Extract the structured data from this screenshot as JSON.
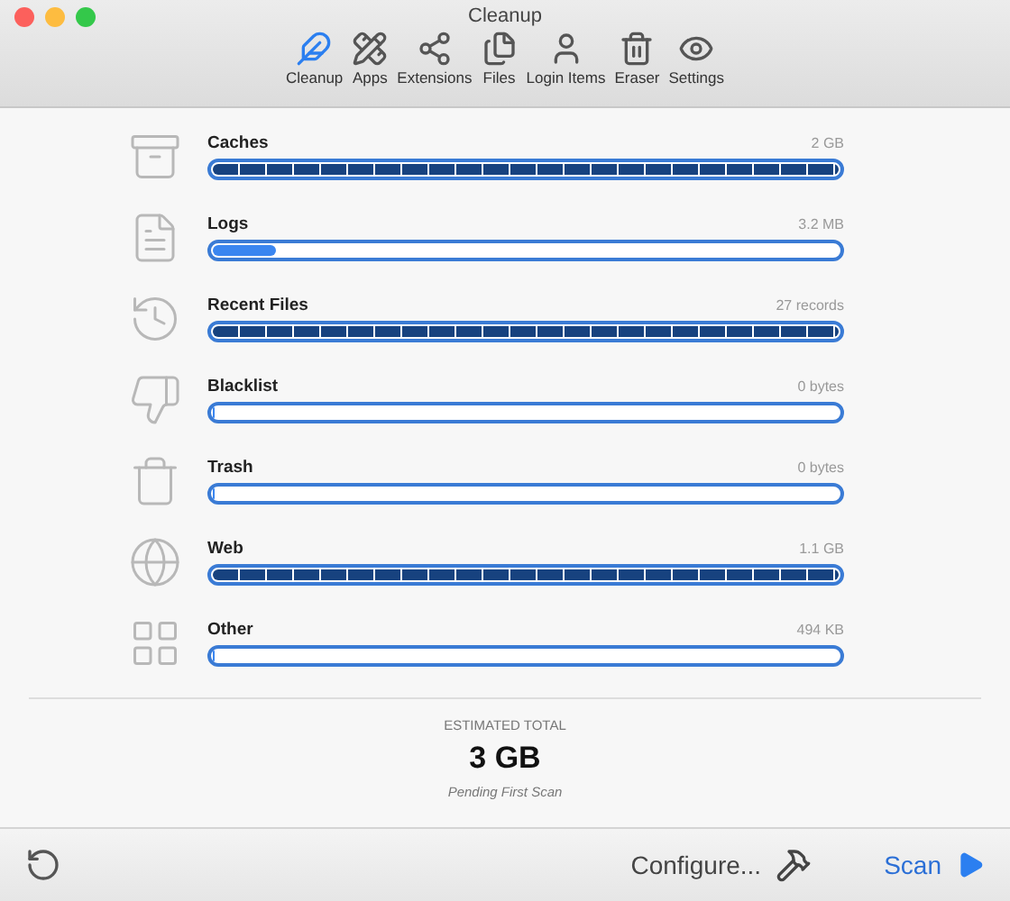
{
  "window": {
    "title": "Cleanup"
  },
  "toolbar": [
    {
      "label": "Cleanup",
      "selected": true
    },
    {
      "label": "Apps",
      "selected": false
    },
    {
      "label": "Extensions",
      "selected": false
    },
    {
      "label": "Files",
      "selected": false
    },
    {
      "label": "Login Items",
      "selected": false
    },
    {
      "label": "Eraser",
      "selected": false
    },
    {
      "label": "Settings",
      "selected": false
    }
  ],
  "categories": [
    {
      "name": "Caches",
      "reading": "2 GB",
      "level": 1
    },
    {
      "name": "Logs",
      "reading": "3.2 MB",
      "level": 0.1
    },
    {
      "name": "Recent Files",
      "reading": "27 records",
      "level": 1
    },
    {
      "name": "Blacklist",
      "reading": "0 bytes",
      "level": 0
    },
    {
      "name": "Trash",
      "reading": "0 bytes",
      "level": 0
    },
    {
      "name": "Web",
      "reading": "1.1 GB",
      "level": 1
    },
    {
      "name": "Other",
      "reading": "494 KB",
      "level": 0
    }
  ],
  "total": {
    "label": "ESTIMATED TOTAL",
    "value": "3 GB",
    "note": "Pending First Scan"
  },
  "bottom_bar": {
    "configure": "Configure...",
    "scan": "Scan"
  }
}
